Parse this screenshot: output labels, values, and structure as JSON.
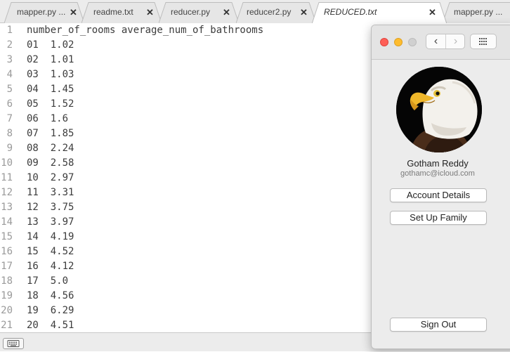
{
  "tabs": [
    {
      "label": "mapper.py ...",
      "close": "✕",
      "active": false
    },
    {
      "label": "readme.txt",
      "close": "✕",
      "active": false
    },
    {
      "label": "reducer.py",
      "close": "✕",
      "active": false
    },
    {
      "label": "reducer2.py",
      "close": "✕",
      "active": false
    },
    {
      "label": "REDUCED.txt",
      "close": "✕",
      "active": true
    },
    {
      "label": "mapper.py ...",
      "close": "",
      "active": false
    }
  ],
  "editor": {
    "lines": [
      {
        "num": "1",
        "text": "number_of_rooms average_num_of_bathrooms"
      },
      {
        "num": "2",
        "text": "01  1.02"
      },
      {
        "num": "3",
        "text": "02  1.01"
      },
      {
        "num": "4",
        "text": "03  1.03"
      },
      {
        "num": "5",
        "text": "04  1.45"
      },
      {
        "num": "6",
        "text": "05  1.52"
      },
      {
        "num": "7",
        "text": "06  1.6"
      },
      {
        "num": "8",
        "text": "07  1.85"
      },
      {
        "num": "9",
        "text": "08  2.24"
      },
      {
        "num": "10",
        "text": "09  2.58"
      },
      {
        "num": "11",
        "text": "10  2.97"
      },
      {
        "num": "12",
        "text": "11  3.31"
      },
      {
        "num": "13",
        "text": "12  3.75"
      },
      {
        "num": "14",
        "text": "13  3.97"
      },
      {
        "num": "15",
        "text": "14  4.19"
      },
      {
        "num": "16",
        "text": "15  4.52"
      },
      {
        "num": "17",
        "text": "16  4.12"
      },
      {
        "num": "18",
        "text": "17  5.0"
      },
      {
        "num": "19",
        "text": "18  4.56"
      },
      {
        "num": "20",
        "text": "19  6.29"
      },
      {
        "num": "21",
        "text": "20  4.51"
      }
    ]
  },
  "statusbar": {
    "keyboard_icon": "keyboard-icon"
  },
  "account_panel": {
    "nav": {
      "back": "‹",
      "forward": "›",
      "grid_icon": "grid-icon"
    },
    "user": {
      "name": "Gotham Reddy",
      "email": "gothamc@icloud.com",
      "avatar_icon": "bald-eagle-avatar"
    },
    "buttons": {
      "account_details": "Account Details",
      "set_up_family": "Set Up Family",
      "sign_out": "Sign Out"
    }
  },
  "colors": {
    "close_red": "#fe5f57",
    "minimize_yellow": "#febc2e",
    "zoom_gray": "#d0d0d0",
    "line_number_gray": "#9a9a9a"
  }
}
